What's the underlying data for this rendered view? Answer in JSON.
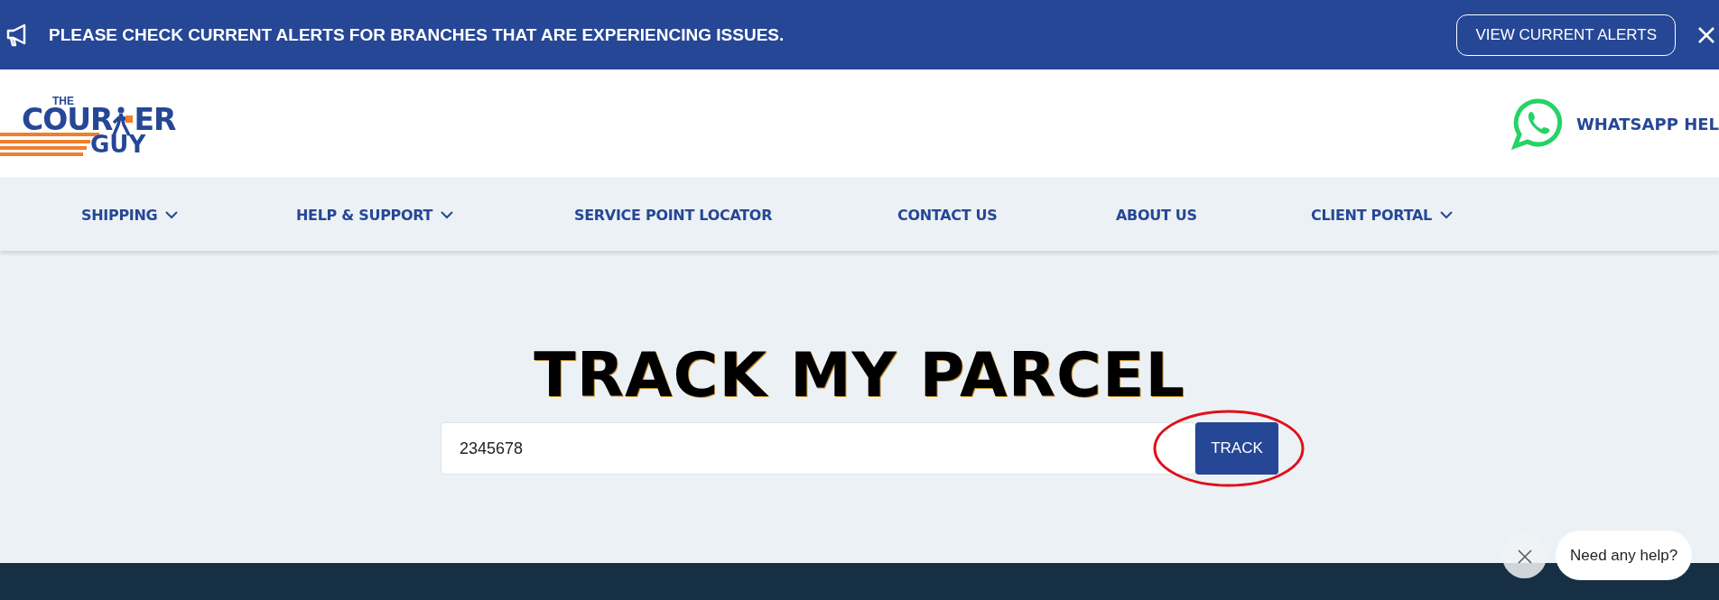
{
  "alert_bar": {
    "message": "PLEASE CHECK CURRENT ALERTS FOR BRANCHES THAT ARE EXPERIENCING ISSUES.",
    "button": "VIEW CURRENT ALERTS"
  },
  "header": {
    "logo": {
      "top": "THE",
      "left": "COUR",
      "right": "ER",
      "bottom": "GUY"
    },
    "whatsapp": "WHATSAPP HEL"
  },
  "nav": [
    {
      "label": "SHIPPING",
      "dropdown": true
    },
    {
      "label": "HELP & SUPPORT",
      "dropdown": true
    },
    {
      "label": "SERVICE POINT LOCATOR",
      "dropdown": false
    },
    {
      "label": "CONTACT US",
      "dropdown": false
    },
    {
      "label": "ABOUT US",
      "dropdown": false
    },
    {
      "label": "CLIENT PORTAL",
      "dropdown": true
    }
  ],
  "tracking": {
    "title": "TRACK MY PARCEL",
    "value": "2345678",
    "button": "TRACK"
  },
  "chat": {
    "message": "Need any help?"
  }
}
